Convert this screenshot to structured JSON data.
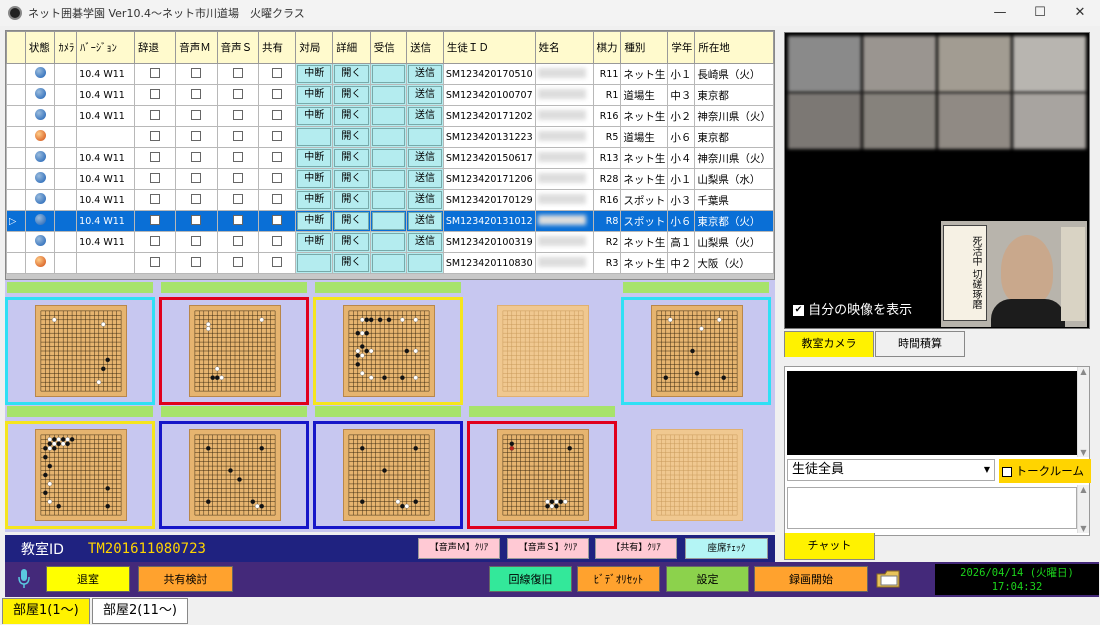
{
  "window": {
    "title": "ネット囲碁学園 Ver10.4～ネット市川道場　火曜クラス",
    "minimize": "—",
    "maximize": "☐",
    "close": "✕"
  },
  "table": {
    "headers": [
      "",
      "状態",
      "ｶﾒﾗ",
      "ﾊﾞｰｼﾞｮﾝ",
      "辞退",
      "音声Ｍ",
      "音声Ｓ",
      "共有",
      "対局",
      "詳細",
      "受信",
      "送信",
      "生徒ＩＤ",
      "姓名",
      "棋力",
      "種別",
      "学年",
      "所在地"
    ],
    "rows": [
      {
        "status": "blue",
        "version": "10.4 W11",
        "taikyoku": "中断",
        "detail": "開く",
        "send": "送信",
        "id": "SM123420170510",
        "rank": "R11",
        "type": "ネット生",
        "grade": "小１",
        "location": "長崎県（火）",
        "selected": false
      },
      {
        "status": "blue",
        "version": "10.4 W11",
        "taikyoku": "中断",
        "detail": "開く",
        "send": "送信",
        "id": "SM123420100707",
        "rank": "R1",
        "type": "道場生",
        "grade": "中３",
        "location": "東京都",
        "selected": false
      },
      {
        "status": "blue",
        "version": "10.4 W11",
        "taikyoku": "中断",
        "detail": "開く",
        "send": "送信",
        "id": "SM123420171202",
        "rank": "R16",
        "type": "ネット生",
        "grade": "小２",
        "location": "神奈川県（火）",
        "selected": false
      },
      {
        "status": "orange",
        "version": "",
        "taikyoku": "",
        "detail": "開く",
        "send": "",
        "id": "SM123420131223",
        "rank": "R5",
        "type": "道場生",
        "grade": "小６",
        "location": "東京都",
        "selected": false
      },
      {
        "status": "blue",
        "version": "10.4 W11",
        "taikyoku": "中断",
        "detail": "開く",
        "send": "送信",
        "id": "SM123420150617",
        "rank": "R13",
        "type": "ネット生",
        "grade": "小４",
        "location": "神奈川県（火）",
        "selected": false
      },
      {
        "status": "blue",
        "version": "10.4 W11",
        "taikyoku": "中断",
        "detail": "開く",
        "send": "送信",
        "id": "SM123420171206",
        "rank": "R28",
        "type": "ネット生",
        "grade": "小１",
        "location": "山梨県（水）",
        "selected": false
      },
      {
        "status": "blue",
        "version": "10.4 W11",
        "taikyoku": "中断",
        "detail": "開く",
        "send": "送信",
        "id": "SM123420170129",
        "rank": "R16",
        "type": "スポット",
        "grade": "小３",
        "location": "千葉県",
        "selected": false
      },
      {
        "status": "blue",
        "version": "10.4 W11",
        "taikyoku": "中断",
        "detail": "開く",
        "send": "送信",
        "id": "SM123420131012",
        "rank": "R8",
        "type": "スポット",
        "grade": "小６",
        "location": "東京都（火）",
        "selected": true
      },
      {
        "status": "blue",
        "version": "10.4 W11",
        "taikyoku": "中断",
        "detail": "開く",
        "send": "送信",
        "id": "SM123420100319",
        "rank": "R2",
        "type": "ネット生",
        "grade": "高１",
        "location": "山梨県（火）",
        "selected": false
      },
      {
        "status": "orange",
        "version": "",
        "taikyoku": "",
        "detail": "開く",
        "send": "",
        "id": "SM123420110830",
        "rank": "R3",
        "type": "ネット生",
        "grade": "中２",
        "location": "大阪（火）",
        "selected": false
      }
    ]
  },
  "colors": {
    "cyan": "#2fe0f5",
    "red": "#e0001c",
    "yellow": "#f5e51c",
    "blue": "#1616c8",
    "board": "#e6b46f",
    "selected_row": "#0a6fd6"
  },
  "boards": [
    {
      "frame": "cyan",
      "empty": false
    },
    {
      "frame": "red",
      "empty": false
    },
    {
      "frame": "yellow",
      "empty": false
    },
    {
      "frame": "none",
      "empty": true
    },
    {
      "frame": "cyan",
      "empty": false
    },
    {
      "frame": "yellow",
      "empty": false
    },
    {
      "frame": "blue",
      "empty": false
    },
    {
      "frame": "blue",
      "empty": false
    },
    {
      "frame": "red",
      "empty": false
    },
    {
      "frame": "none",
      "empty": true
    }
  ],
  "footer": {
    "room_id_label": "教室ID",
    "room_id": "TM201611080723",
    "clear_m": "【音声Ｍ】ｸﾘｱ",
    "clear_s": "【音声Ｓ】ｸﾘｱ",
    "clear_share": "【共有】ｸﾘｱ",
    "seat_check": "座席ﾁｪｯｸ"
  },
  "commands": {
    "exit": "退室",
    "shared_review": "共有検討",
    "reconnect": "回線復旧",
    "video_reset": "ﾋﾞﾃﾞｵﾘｾｯﾄ",
    "settings": "設定",
    "record": "録画開始"
  },
  "clock": {
    "date": "2026/04/14 (火曜日)",
    "time": "17:04:32"
  },
  "tabs": {
    "room1": "部屋1(1～)",
    "room2": "部屋2(11～)"
  },
  "video": {
    "show_self": "自分の映像を表示",
    "sign": "死活中  切磋琢磨"
  },
  "camera_tabs": {
    "classroom_camera": "教室カメラ",
    "time_total": "時間積算"
  },
  "chat": {
    "recipient": "生徒全員",
    "talk_room": "トークルーム",
    "send_button": "チャット"
  }
}
